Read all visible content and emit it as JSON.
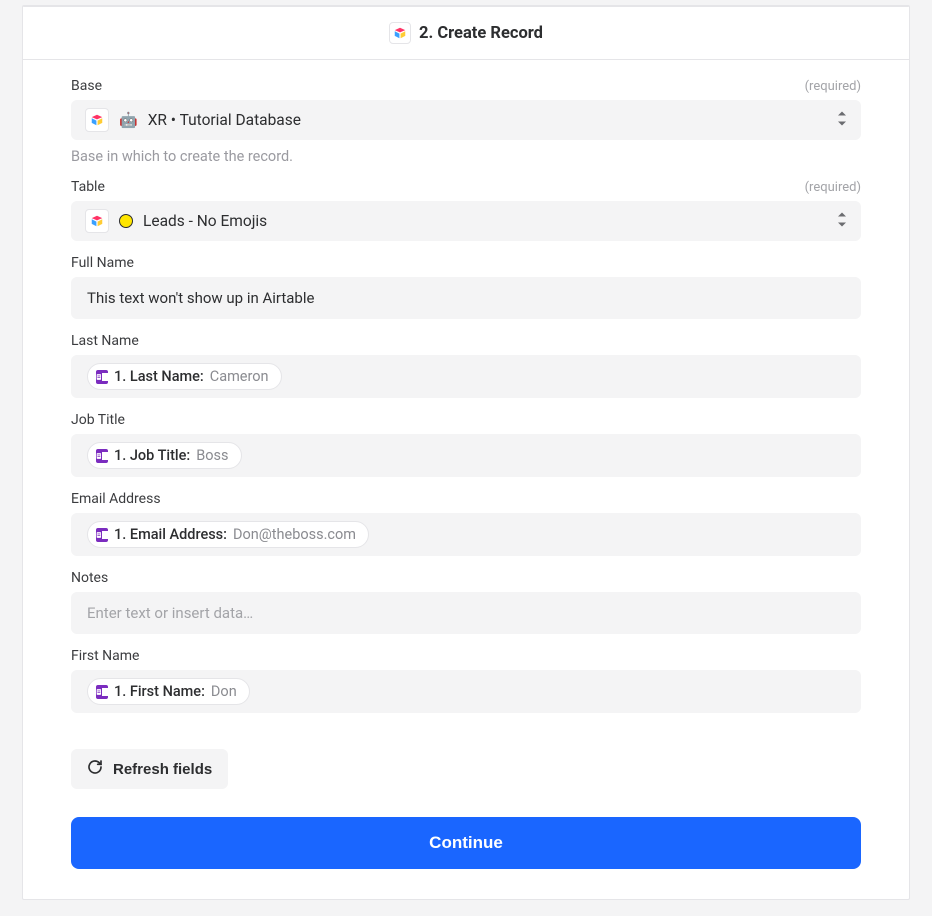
{
  "header": {
    "title": "2. Create Record"
  },
  "fields": {
    "base": {
      "label": "Base",
      "required_text": "(required)",
      "emoji": "🤖",
      "value": "XR • Tutorial Database",
      "helper": "Base in which to create the record."
    },
    "table": {
      "label": "Table",
      "required_text": "(required)",
      "value": "Leads - No Emojis"
    },
    "full_name": {
      "label": "Full Name",
      "value": "This text won't show up in Airtable"
    },
    "last_name": {
      "label": "Last Name",
      "pill_label": "1. Last Name:",
      "pill_value": "Cameron"
    },
    "job_title": {
      "label": "Job Title",
      "pill_label": "1. Job Title:",
      "pill_value": "Boss"
    },
    "email": {
      "label": "Email Address",
      "pill_label": "1. Email Address:",
      "pill_value": "Don@theboss.com"
    },
    "notes": {
      "label": "Notes",
      "placeholder": "Enter text or insert data…"
    },
    "first_name": {
      "label": "First Name",
      "pill_label": "1. First Name:",
      "pill_value": "Don"
    }
  },
  "buttons": {
    "refresh": "Refresh fields",
    "continue": "Continue"
  }
}
